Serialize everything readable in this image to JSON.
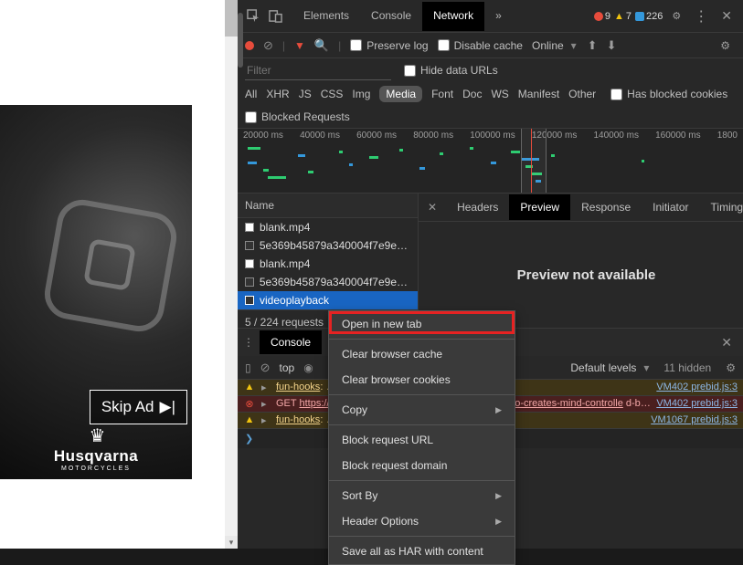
{
  "page": {
    "skip_ad": "Skip Ad",
    "brand": "Husqvarna",
    "brand_sub": "MOTORCYCLES"
  },
  "top_tabs": [
    "Elements",
    "Console",
    "Network"
  ],
  "top_active": 2,
  "badges": {
    "errors": "9",
    "warnings": "7",
    "info": "226"
  },
  "toolbar": {
    "preserve": "Preserve log",
    "disable_cache": "Disable cache",
    "throttle": "Online"
  },
  "filter_placeholder": "Filter",
  "hide_urls": "Hide data URLs",
  "filter_types": [
    "All",
    "XHR",
    "JS",
    "CSS",
    "Img",
    "Media",
    "Font",
    "Doc",
    "WS",
    "Manifest",
    "Other"
  ],
  "filter_active": 5,
  "has_blocked": "Has blocked cookies",
  "blocked_req": "Blocked Requests",
  "timeline_ticks": [
    "20000 ms",
    "40000 ms",
    "60000 ms",
    "80000 ms",
    "100000 ms",
    "120000 ms",
    "140000 ms",
    "160000 ms",
    "1800"
  ],
  "col_name": "Name",
  "rows": [
    {
      "name": "blank.mp4",
      "sel": false,
      "filled": false
    },
    {
      "name": "5e369b45879a340004f7e9e3…",
      "sel": false,
      "filled": true
    },
    {
      "name": "blank.mp4",
      "sel": false,
      "filled": false
    },
    {
      "name": "5e369b45879a340004f7e9e3…",
      "sel": false,
      "filled": true
    },
    {
      "name": "videoplayback",
      "sel": true,
      "filled": true
    }
  ],
  "req_count": "5 / 224 requests",
  "detail_tabs": [
    "Headers",
    "Preview",
    "Response",
    "Initiator",
    "Timing"
  ],
  "detail_active": 1,
  "preview_msg": "Preview not available",
  "ctx_menu": [
    {
      "label": "Open in new tab",
      "t": "i"
    },
    {
      "t": "sep"
    },
    {
      "label": "Clear browser cache",
      "t": "i"
    },
    {
      "label": "Clear browser cookies",
      "t": "i"
    },
    {
      "t": "sep"
    },
    {
      "label": "Copy",
      "t": "sub"
    },
    {
      "t": "sep"
    },
    {
      "label": "Block request URL",
      "t": "i"
    },
    {
      "label": "Block request domain",
      "t": "i"
    },
    {
      "t": "sep"
    },
    {
      "label": "Sort By",
      "t": "sub"
    },
    {
      "label": "Header Options",
      "t": "sub"
    },
    {
      "t": "sep"
    },
    {
      "label": "Save all as HAR with content",
      "t": "i"
    }
  ],
  "console": {
    "tab": "Console",
    "context": "top",
    "levels": "Default levels",
    "hidden": "11 hidden",
    "rows": [
      {
        "kind": "warn",
        "msg": "fun-hooks: […] was registered, but it was never created",
        "src": "VM402 prebid.js:3"
      },
      {
        "kind": "err",
        "msg": "GET https://… e=q017o-bzz… /ad/tag?adCod …chicago-creates-mind-controlled-bionic-le…",
        "src": "VM402 prebid.js:3"
      },
      {
        "kind": "warn",
        "msg": "fun-hooks: […] was registered, but it was never created",
        "src": "VM1067 prebid.js:3"
      }
    ]
  }
}
